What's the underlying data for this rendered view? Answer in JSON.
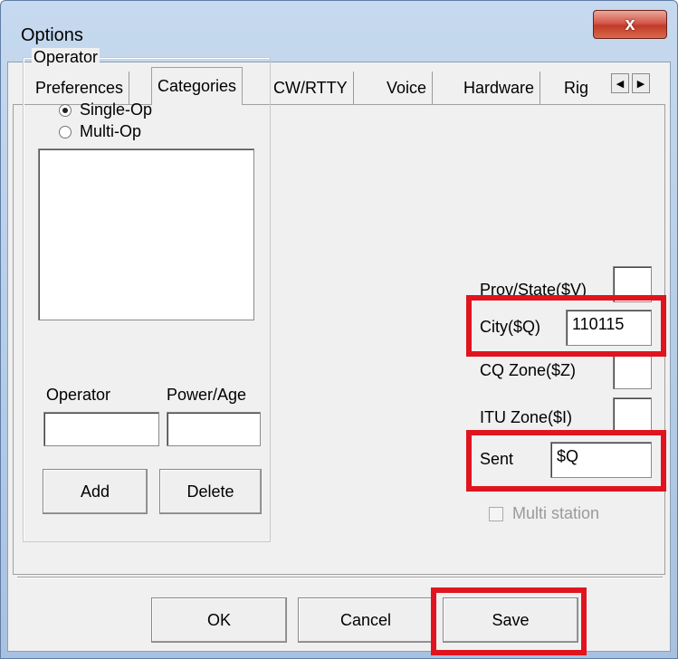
{
  "window": {
    "title": "Options",
    "close_label": "x"
  },
  "tabs": [
    "Preferences",
    "Categories",
    "CW/RTTY",
    "Voice",
    "Hardware",
    "Rig"
  ],
  "tab_scroll": {
    "left": "◀",
    "right": "▶"
  },
  "operator_group": {
    "label": "Operator",
    "options": [
      "Single-Op",
      "Multi-Op"
    ],
    "selected": "Single-Op"
  },
  "operator_field": {
    "label": "Operator",
    "value": ""
  },
  "power_field": {
    "label": "Power/Age",
    "value": ""
  },
  "add_label": "Add",
  "delete_label": "Delete",
  "fields": {
    "prov_state": {
      "label": "Prov/State($V)",
      "value": ""
    },
    "city": {
      "label": "City($Q)",
      "value": "110115"
    },
    "cq_zone": {
      "label": "CQ Zone($Z)",
      "value": ""
    },
    "itu_zone": {
      "label": "ITU Zone($I)",
      "value": ""
    },
    "sent": {
      "label": "Sent",
      "value": "$Q"
    }
  },
  "multi_station": {
    "label": "Multi station",
    "checked": false,
    "enabled": false
  },
  "buttons": {
    "ok": "OK",
    "cancel": "Cancel",
    "save": "Save"
  },
  "colors": {
    "highlight": "#e0141e",
    "dialog_bg": "#f0f0f0",
    "frame": "#b4cbe6"
  }
}
